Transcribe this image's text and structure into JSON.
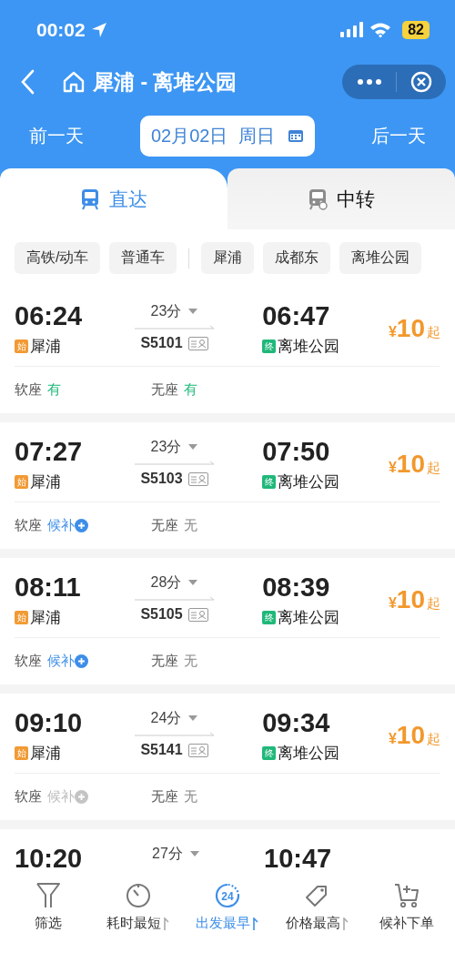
{
  "status_bar": {
    "time": "00:02",
    "battery": "82"
  },
  "nav": {
    "title": "犀浦 - 离堆公园"
  },
  "date_bar": {
    "prev": "前一天",
    "date": "02月02日  周日",
    "next": "后一天"
  },
  "tabs": [
    {
      "label": "直达",
      "selected": true
    },
    {
      "label": "中转",
      "selected": false
    }
  ],
  "filters": [
    {
      "label": "高铁/动车"
    },
    {
      "label": "普通车"
    },
    {
      "label": "犀浦",
      "divider_before": true
    },
    {
      "label": "成都东"
    },
    {
      "label": "离堆公园"
    }
  ],
  "trains": [
    {
      "depart": "06:24",
      "from_tag": "始",
      "from": "犀浦",
      "duration": "23分",
      "number": "S5101",
      "arrive": "06:47",
      "to_tag": "终",
      "to": "离堆公园",
      "price_symbol": "¥",
      "price": "10",
      "price_suffix": "起",
      "seats": [
        {
          "label": "软座",
          "status": "有",
          "kind": "available"
        },
        {
          "label": "无座",
          "status": "有",
          "kind": "available"
        }
      ]
    },
    {
      "depart": "07:27",
      "from_tag": "始",
      "from": "犀浦",
      "duration": "23分",
      "number": "S5103",
      "arrive": "07:50",
      "to_tag": "终",
      "to": "离堆公园",
      "price_symbol": "¥",
      "price": "10",
      "price_suffix": "起",
      "seats": [
        {
          "label": "软座",
          "status": "候补",
          "kind": "waitlist"
        },
        {
          "label": "无座",
          "status": "无",
          "kind": "none"
        }
      ]
    },
    {
      "depart": "08:11",
      "from_tag": "始",
      "from": "犀浦",
      "duration": "28分",
      "number": "S5105",
      "arrive": "08:39",
      "to_tag": "终",
      "to": "离堆公园",
      "price_symbol": "¥",
      "price": "10",
      "price_suffix": "起",
      "seats": [
        {
          "label": "软座",
          "status": "候补",
          "kind": "waitlist"
        },
        {
          "label": "无座",
          "status": "无",
          "kind": "none"
        }
      ]
    },
    {
      "depart": "09:10",
      "from_tag": "始",
      "from": "犀浦",
      "duration": "24分",
      "number": "S5141",
      "arrive": "09:34",
      "to_tag": "终",
      "to": "离堆公园",
      "price_symbol": "¥",
      "price": "10",
      "price_suffix": "起",
      "seats": [
        {
          "label": "软座",
          "status": "候补",
          "kind": "waitlist_disabled"
        },
        {
          "label": "无座",
          "status": "无",
          "kind": "none"
        }
      ]
    },
    {
      "depart": "10:20",
      "duration": "27分",
      "arrive": "10:47"
    }
  ],
  "bottom_bar": [
    {
      "label": "筛选",
      "kind": "filter",
      "selected": false,
      "sortable": false
    },
    {
      "label": "耗时最短",
      "kind": "timer",
      "selected": false,
      "sortable": true
    },
    {
      "label": "出发最早",
      "kind": "clock24",
      "icon_text": "24",
      "selected": true,
      "sortable": true
    },
    {
      "label": "价格最高",
      "kind": "tag",
      "selected": false,
      "sortable": true
    },
    {
      "label": "候补下单",
      "kind": "cart",
      "selected": false,
      "sortable": false
    }
  ]
}
